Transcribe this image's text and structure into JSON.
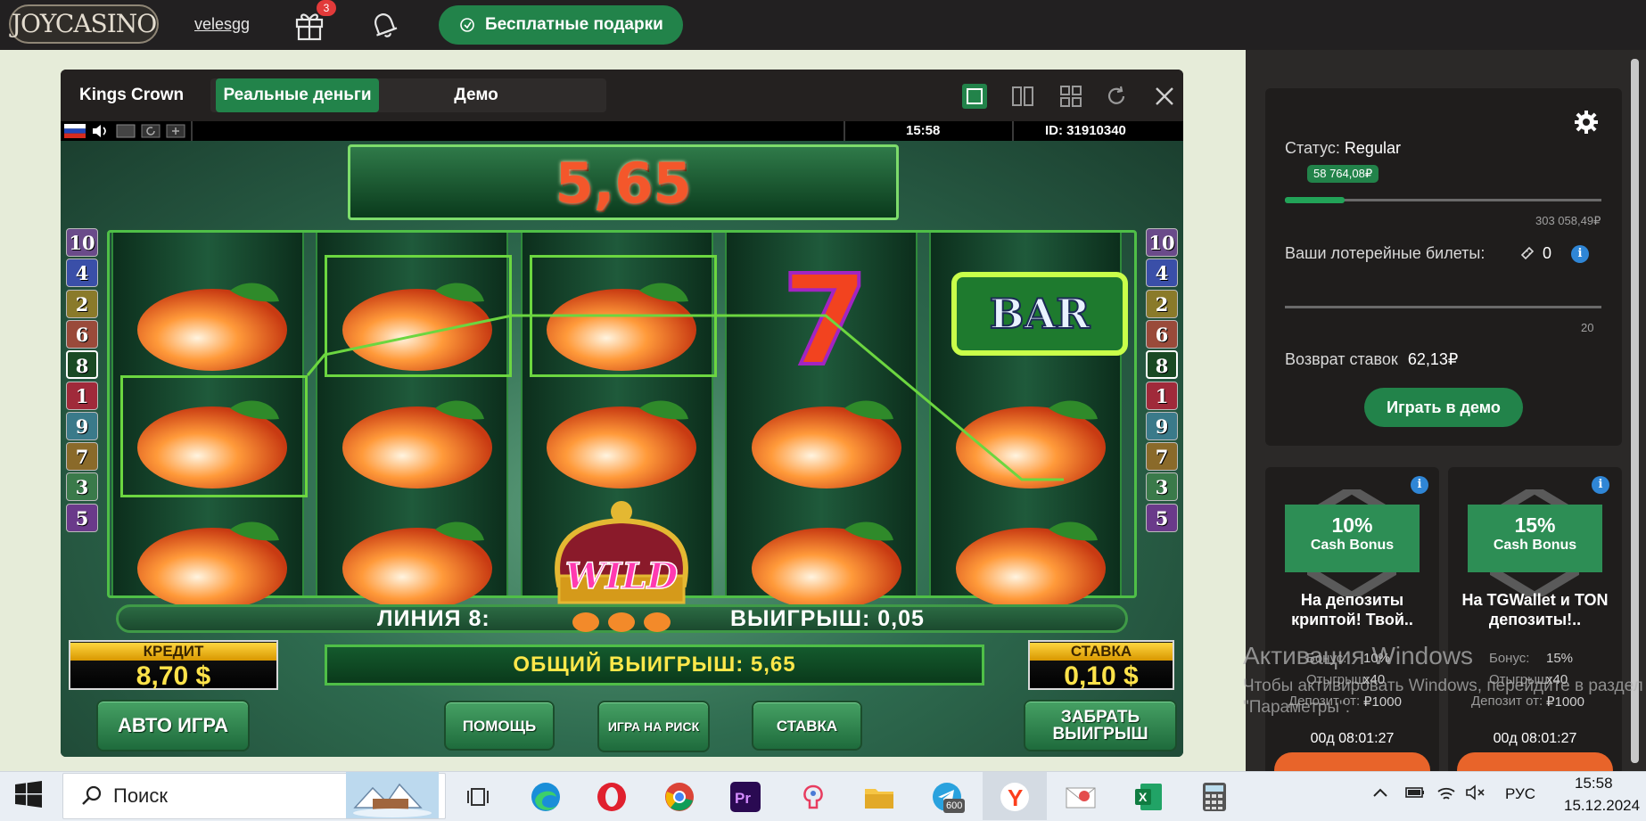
{
  "header": {
    "logo": "JOYCASINO",
    "username": "velesgg",
    "gift_badge": "3",
    "free_gifts_label": "Бесплатные подарки"
  },
  "game": {
    "title": "Kings Crown",
    "tab_real": "Реальные деньги",
    "tab_demo": "Демо",
    "status_time": "15:58",
    "status_id": "ID: 31910340",
    "win_amount": "5,65",
    "line_label": "ЛИНИЯ 8:",
    "line_win": "ВЫИГРЫШ: 0,05",
    "credit_label": "КРЕДИТ",
    "credit_value": "8,70 $",
    "total_win": "ОБЩИЙ ВЫИГРЫШ: 5,65",
    "stake_label": "СТАВКА",
    "stake_value": "0,10 $",
    "btn_auto": "АВТО ИГРА",
    "btn_help": "ПОМОЩЬ",
    "btn_risk": "ИГРА НА РИСК",
    "btn_stake": "СТАВКА",
    "btn_collect": "ЗАБРАТЬ ВЫИГРЫШ",
    "line_numbers_left": [
      "10",
      "4",
      "2",
      "6",
      "8",
      "1",
      "9",
      "7",
      "3",
      "5"
    ],
    "line_numbers_right": [
      "10",
      "4",
      "2",
      "6",
      "8",
      "1",
      "9",
      "7",
      "3",
      "5"
    ],
    "symbols": {
      "bar": "BAR",
      "wild": "WILD",
      "seven": "7"
    }
  },
  "sidebar": {
    "status_label": "Статус:",
    "status_value": "Regular",
    "points": "58 764,08₽",
    "points_max": "303 058,49₽",
    "progress_fraction": 0.19,
    "tickets_label": "Ваши лотерейные билеты:",
    "tickets_count": "0",
    "tickets_max": "20",
    "cashback_label": "Возврат ставок",
    "cashback_value": "62,13₽",
    "demo_button": "Играть в демо",
    "bonuses": [
      {
        "percent": "10%",
        "name": "Cash Bonus",
        "title": "На депозиты криптой! Твой..",
        "bonus_label": "Бонус:",
        "bonus_value": "10%",
        "wager_label": "Отыгрыш:",
        "wager_value": "x40",
        "deposit_label": "Депозит от:",
        "deposit_value": "₽1000",
        "timer": "00д  08:01:27"
      },
      {
        "percent": "15%",
        "name": "Cash Bonus",
        "title": "На TGWallet и TON депозиты!..",
        "bonus_label": "Бонус:",
        "bonus_value": "15%",
        "wager_label": "Отыгрыш:",
        "wager_value": "x40",
        "deposit_label": "Депозит от:",
        "deposit_value": "₽1000",
        "timer": "00д  08:01:27"
      }
    ]
  },
  "watermark": {
    "title": "Активация Windows",
    "text": "Чтобы активировать Windows, перейдите в раздел \"Параметры\"."
  },
  "taskbar": {
    "search_placeholder": "Поиск",
    "telegram_badge": "600",
    "language": "РУС",
    "time": "15:58",
    "date": "15.12.2024"
  },
  "colors": {
    "brand_green": "#22834a",
    "header_bg": "#222021",
    "page_bg": "#e6ecd9",
    "panel_bg": "#2b2928"
  }
}
